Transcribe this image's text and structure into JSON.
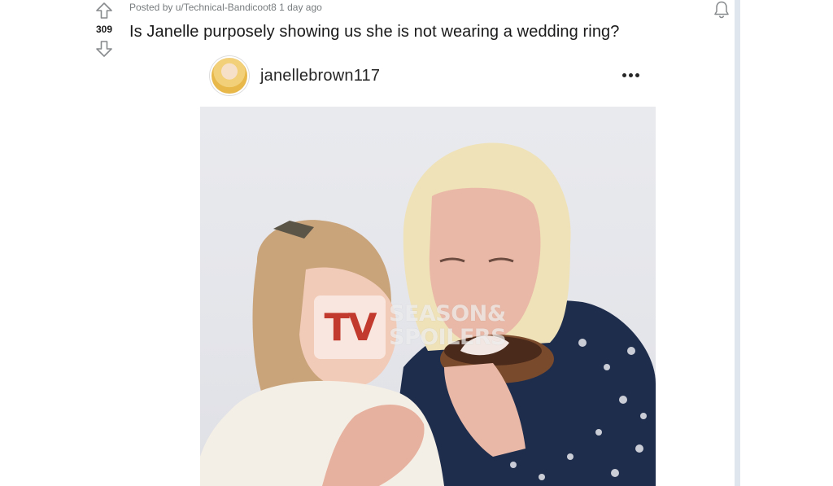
{
  "post": {
    "meta_prefix": "Posted by ",
    "author": "u/Technical-Bandicoot8",
    "time_ago": " 1 day ago",
    "score": "309",
    "title": "Is Janelle purposely showing us she is not wearing a wedding ring?"
  },
  "icons": {
    "upvote": "arrow-up-icon",
    "downvote": "arrow-down-icon",
    "notify": "bell-icon",
    "more": "more-horizontal-icon"
  },
  "instagram": {
    "username": "janellebrown117"
  },
  "watermark": {
    "logo": "TV",
    "line1": "SEASON&",
    "line2": "SPOILERS"
  },
  "colors": {
    "text": "#1a1a1b",
    "meta": "#787c7e",
    "watermark_red": "#c23a2e"
  }
}
